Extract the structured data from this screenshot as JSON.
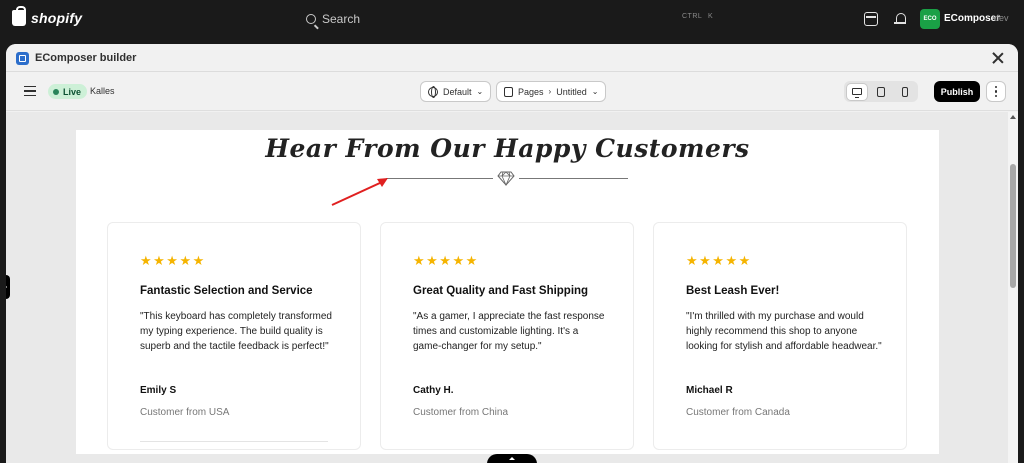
{
  "shopify": {
    "logo_text": "shopify",
    "search_placeholder": "Search",
    "shortcut_ctrl": "CTRL",
    "shortcut_key": "K",
    "avatar_initials": "ECO",
    "store_name": "EComposer",
    "store_suffix": "dev"
  },
  "window": {
    "title": "EComposer builder"
  },
  "toolbar": {
    "status": "Live",
    "theme": "Kalles",
    "language_label": "Default",
    "pages_label": "Pages",
    "page_name": "Untitled",
    "publish_label": "Publish"
  },
  "section": {
    "title": "Hear From Our Happy Customers"
  },
  "testimonials": [
    {
      "stars": "★★★★★",
      "title": "Fantastic Selection and Service",
      "text": "\"This keyboard has completely transformed my typing experience. The build quality is superb and the tactile feedback is perfect!\"",
      "name": "Emily S",
      "location": "Customer from USA"
    },
    {
      "stars": "★★★★★",
      "title": "Great Quality and Fast Shipping",
      "text": "\"As a gamer, I appreciate the fast response times and customizable lighting. It's a game-changer for my setup.\"",
      "name": "Cathy H.",
      "location": "Customer from China"
    },
    {
      "stars": "★★★★★",
      "title": "Best Leash Ever!",
      "text": "\"I'm thrilled with my purchase and would highly recommend this shop to anyone looking for stylish and affordable headwear.\"",
      "name": "Michael R",
      "location": "Customer from Canada"
    }
  ],
  "colors": {
    "star": "#f5b400",
    "live_badge_bg": "#cdf0d7",
    "avatar_bg": "#1aa046",
    "annotation_arrow": "#e02020"
  },
  "icons": [
    "shopify-bag-icon",
    "search-icon",
    "store-icon",
    "bell-icon",
    "ecomposer-app-icon",
    "close-icon",
    "menu-icon",
    "globe-icon",
    "page-icon",
    "chevron-down-icon",
    "desktop-icon",
    "tablet-icon",
    "mobile-icon",
    "more-icon",
    "diamond-icon",
    "arrow-icon"
  ]
}
